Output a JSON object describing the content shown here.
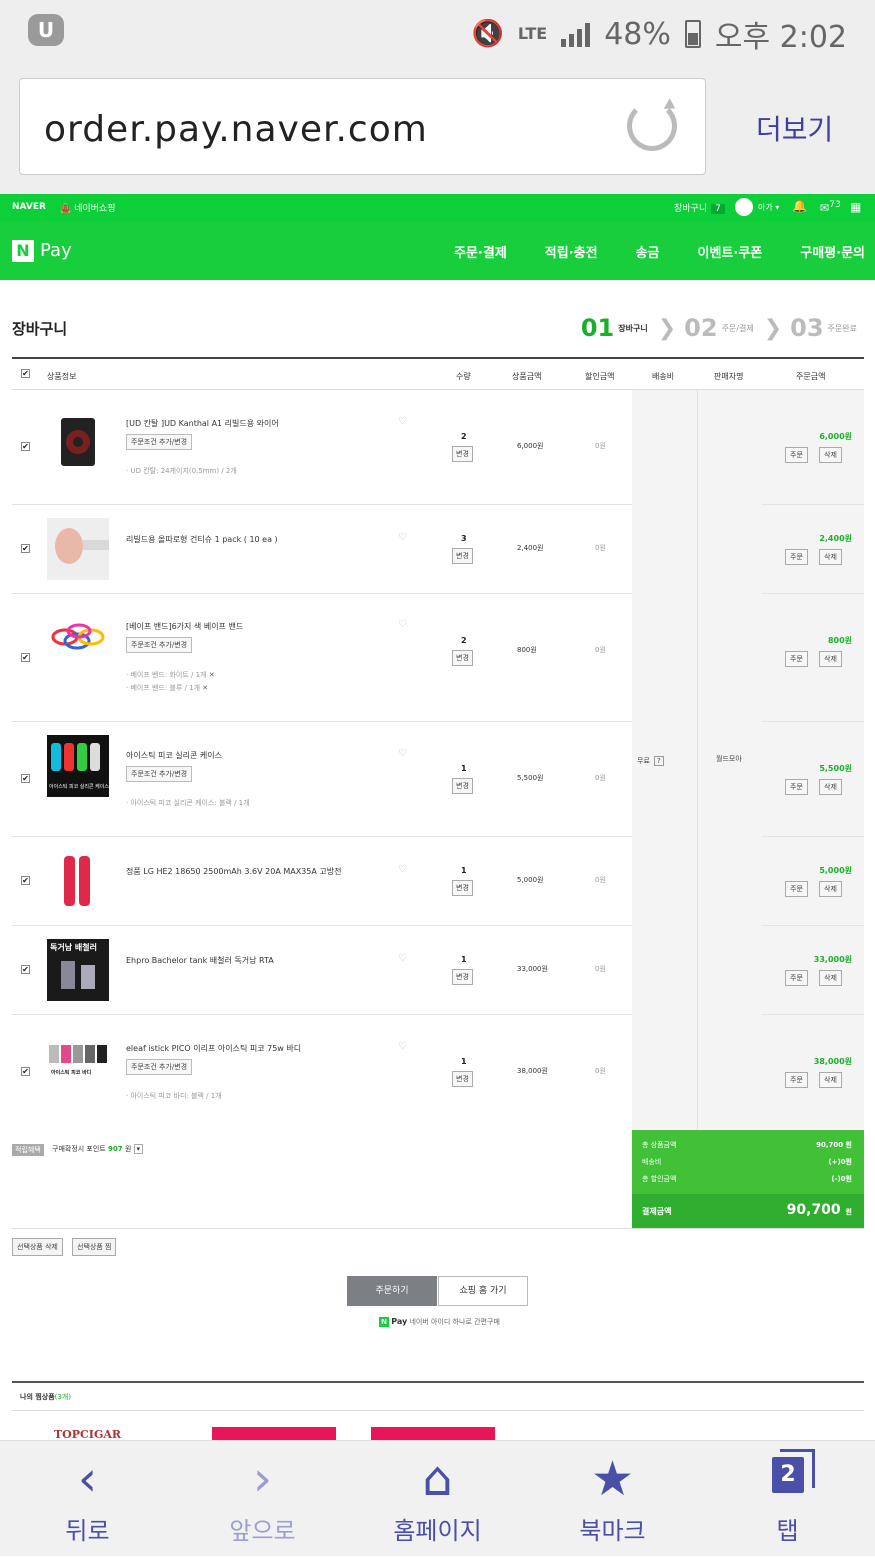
{
  "status": {
    "battery": "48%",
    "time": "오후 2:02",
    "network": "LTE"
  },
  "browser": {
    "url": "order.pay.naver.com",
    "more_label": "더보기"
  },
  "naver_top": {
    "brand": "NAVER",
    "shopping": "네이버쇼핑",
    "cart_label": "장바구니",
    "cart_count": "7",
    "user": "아가",
    "mail_count": "73"
  },
  "paybar": {
    "logo": "N",
    "name": "Pay",
    "nav": [
      "주문·결제",
      "적립·충전",
      "송금",
      "이벤트·쿠폰",
      "구매평·문의"
    ]
  },
  "page": {
    "title": "장바구니"
  },
  "steps": [
    {
      "num": "01",
      "label": "장바구니",
      "active": true
    },
    {
      "num": "02",
      "label": "주문/결제",
      "active": false
    },
    {
      "num": "03",
      "label": "주문완료",
      "active": false
    }
  ],
  "table_headers": {
    "product": "상품정보",
    "qty": "수량",
    "price": "상품금액",
    "discount": "할인금액",
    "shipping": "배송비",
    "seller": "판매자명",
    "order_total": "주문금액"
  },
  "items": [
    {
      "name": "[UD 칸탈 ]UD Kanthal A1 리빌드용 와이어",
      "option_btn": "주문조건 추가/변경",
      "options": [
        "· UD 칸탈: 24게이지(0.5mm) / 2개"
      ],
      "qty": "2",
      "price": "6,000원",
      "discount": "0원",
      "total": "6,000원"
    },
    {
      "name": "리빌드용 올따로형 건티슈 1 pack ( 10 ea )",
      "option_btn": "",
      "options": [],
      "qty": "3",
      "price": "2,400원",
      "discount": "0원",
      "total": "2,400원"
    },
    {
      "name": "[베이프 밴드]6가지 색 베이프 밴드",
      "option_btn": "주문조건 추가/변경",
      "options": [
        "· 베이프 밴드: 화이트 / 1개",
        "· 베이프 밴드: 블루 / 1개"
      ],
      "qty": "2",
      "price": "800원",
      "discount": "0원",
      "total": "800원"
    },
    {
      "name": "아이스틱 피코 실리콘 케이스",
      "option_btn": "주문조건 추가/변경",
      "options": [
        "· 아이스틱 피코 실리콘 케이스: 블랙 / 1개"
      ],
      "qty": "1",
      "price": "5,500원",
      "discount": "0원",
      "total": "5,500원"
    },
    {
      "name": "정품 LG HE2 18650 2500mAh 3.6V 20A MAX35A 고방전",
      "option_btn": "",
      "options": [],
      "qty": "1",
      "price": "5,000원",
      "discount": "0원",
      "total": "5,000원"
    },
    {
      "name": "Ehpro Bachelor tank 배철러 독거남 RTA",
      "option_btn": "",
      "options": [],
      "qty": "1",
      "price": "33,000원",
      "discount": "0원",
      "total": "33,000원"
    },
    {
      "name": "eleaf istick PICO 이리프 아이스틱 피코 75w 바디",
      "option_btn": "주문조건 추가/변경",
      "options": [
        "· 아이스틱 피코 바디: 블랙 / 1개"
      ],
      "qty": "1",
      "price": "38,000원",
      "discount": "0원",
      "total": "38,000원"
    }
  ],
  "row_labels": {
    "change": "변경",
    "order": "주문",
    "delete": "삭제",
    "remove_x": "✕"
  },
  "thumb_text": {
    "item4": "아이스틱 피코 실리콘 케이스",
    "item6": "독거남 배철러",
    "item7": "아이스틱 피코 바디"
  },
  "shipping": {
    "value": "무료",
    "help": "?"
  },
  "seller": "월드모아",
  "points": {
    "label": "적립혜택",
    "text": "구매확정시 포인트",
    "value": "907",
    "unit": "원"
  },
  "summary": {
    "product_total_label": "총 상품금액",
    "product_total": "90,700 원",
    "shipping_label": "배송비",
    "shipping": "(+)0원",
    "discount_label": "총 할인금액",
    "discount": "(-)0원",
    "pay_label": "결제금액",
    "pay": "90,700",
    "pay_unit": "원"
  },
  "actions": {
    "delete_selected": "선택상품 삭제",
    "wish_selected": "선택상품 찜",
    "order": "주문하기",
    "continue": "쇼핑 홈 가기"
  },
  "npay_note": {
    "logo": "N",
    "brand": "Pay",
    "text": "네이버 아이디 하나로 간편구매"
  },
  "wish": {
    "title": "나의 찜상품",
    "count": "(3개)",
    "brand_a": "TOPCIGAR"
  },
  "bottom_nav": {
    "back": "뒤로",
    "forward": "앞으로",
    "home": "홈페이지",
    "bookmark": "북마크",
    "tabs": "탭",
    "tab_count": "2"
  }
}
